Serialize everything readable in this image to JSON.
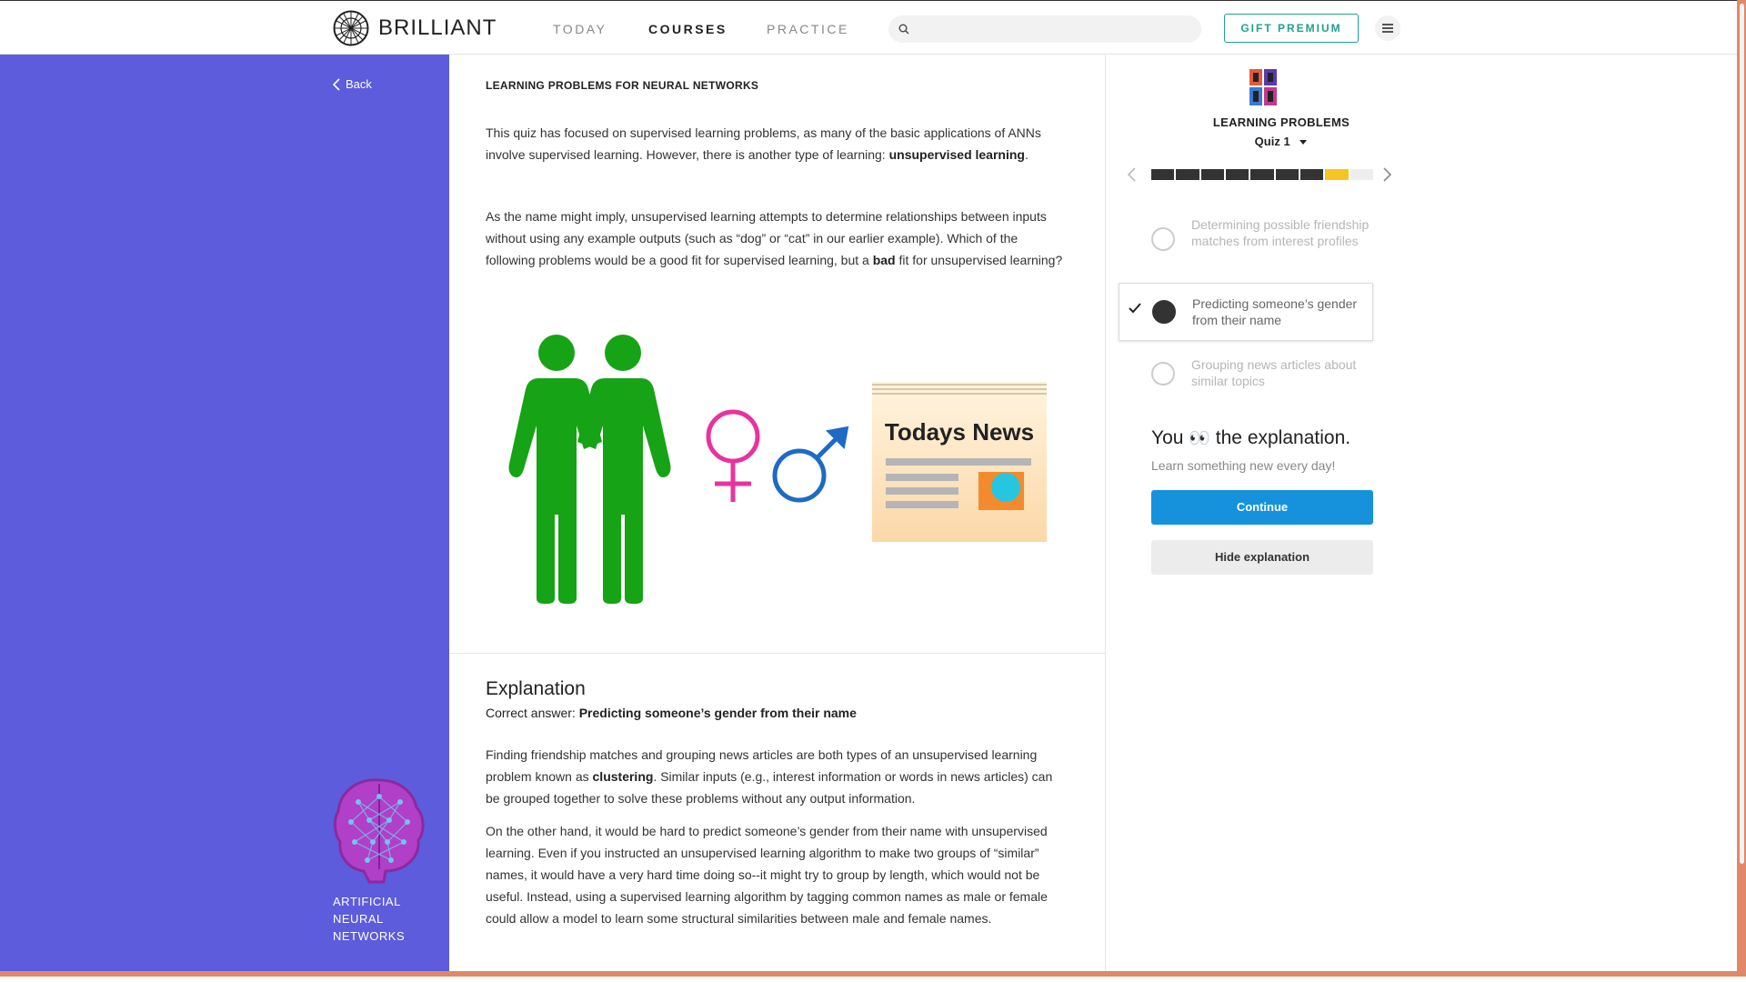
{
  "nav": {
    "brand": "BRILLIANT",
    "items": [
      {
        "label": "TODAY"
      },
      {
        "label": "COURSES"
      },
      {
        "label": "PRACTICE"
      }
    ],
    "search_placeholder": "",
    "gift_label": "GIFT PREMIUM"
  },
  "sidebar": {
    "back_label": "Back",
    "course_name": "ARTIFICIAL NEURAL NETWORKS"
  },
  "problem": {
    "title": "LEARNING PROBLEMS FOR NEURAL NETWORKS",
    "p1_pre": "This quiz has focused on supervised learning problems, as many of the basic applications of ANNs involve supervised learning. However, there is another type of learning: ",
    "p1_bold": "unsupervised learning",
    "p1_post": ".",
    "p2_pre": "As the name might imply, unsupervised learning attempts to determine relationships between inputs without using any example outputs (such as “dog” or “cat” in our earlier example). Which of the following problems would be a good fit for supervised learning, but a ",
    "p2_bold": "bad",
    "p2_post": " fit for unsupervised learning?",
    "news_headline": "Todays News"
  },
  "explanation": {
    "title": "Explanation",
    "correct_prefix": "Correct answer: ",
    "correct_answer": "Predicting someone’s gender from their name",
    "e1_pre": "Finding friendship matches and grouping news articles are both types of an unsupervised learning problem known as ",
    "e1_bold": "clustering",
    "e1_post": ". Similar inputs (e.g., interest information or words in news articles) can be grouped together to solve these problems without any output information.",
    "e2": "On the other hand, it would be hard to predict someone’s gender from their name with unsupervised learning. Even if you instructed an unsupervised learning algorithm to make two groups of “similar” names, it would have a very hard time doing so--it might try to group by length, which would not be useful. Instead, using a supervised learning algorithm by tagging common names as male or female could allow a model to learn some structural similarities between male and female names."
  },
  "quiz": {
    "chapter": "LEARNING PROBLEMS",
    "quiz_label": "Quiz 1",
    "progress": {
      "total_steps": 9,
      "completed_steps": 7,
      "current_step": 8,
      "completed_color": "#333333",
      "current_color": "#f7c521",
      "remaining_color": "#eeeeee"
    },
    "options": [
      {
        "label": "Determining possible friendship matches from interest profiles",
        "selected": false
      },
      {
        "label": "Predicting someone’s gender from their name",
        "selected": true
      },
      {
        "label": "Grouping news articles about similar topics",
        "selected": false
      }
    ],
    "result_pre": "You",
    "result_emoji": "👀",
    "result_post": "the explanation.",
    "result_sub": "Learn something new every day!",
    "continue_label": "Continue",
    "hide_label": "Hide explanation"
  },
  "colors": {
    "sidebar_bg": "#5c5cdd",
    "accent_teal": "#20a090",
    "continue_blue": "#1692dd",
    "scrollbar": "#e08868"
  }
}
